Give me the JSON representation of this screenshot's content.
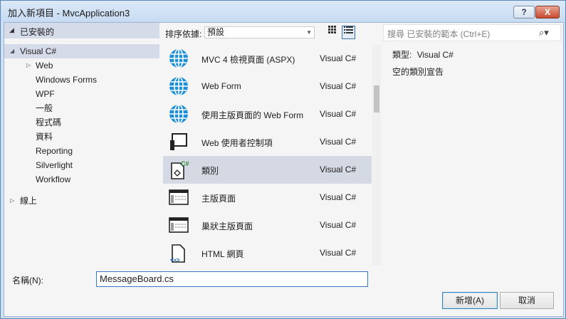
{
  "window": {
    "title": "加入新項目 - MvcApplication3",
    "help_label": "?",
    "close_label": "X"
  },
  "left_panel": {
    "header": "已安裝的",
    "tree": [
      {
        "label": "Visual C#",
        "level": 0,
        "expander": "◢",
        "selected": true
      },
      {
        "label": "Web",
        "level": 1,
        "expander": "▷"
      },
      {
        "label": "Windows Forms",
        "level": 1
      },
      {
        "label": "WPF",
        "level": 1
      },
      {
        "label": "一般",
        "level": 1
      },
      {
        "label": "程式碼",
        "level": 1
      },
      {
        "label": "資料",
        "level": 1
      },
      {
        "label": "Reporting",
        "level": 1
      },
      {
        "label": "Silverlight",
        "level": 1
      },
      {
        "label": "Workflow",
        "level": 1
      },
      {
        "label": "線上",
        "level": 0,
        "expander": "▷"
      }
    ]
  },
  "toolbar": {
    "sort_label": "排序依據:",
    "sort_value": "預設"
  },
  "templates": [
    {
      "name": "MVC 4 檢視頁面 (ASPX)",
      "lang": "Visual C#",
      "icon": "globe-icon"
    },
    {
      "name": "Web Form",
      "lang": "Visual C#",
      "icon": "globe-icon"
    },
    {
      "name": "使用主版頁面的 Web Form",
      "lang": "Visual C#",
      "icon": "globe-icon"
    },
    {
      "name": "Web 使用者控制項",
      "lang": "Visual C#",
      "icon": "user-control-icon"
    },
    {
      "name": "類別",
      "lang": "Visual C#",
      "icon": "class-file-icon",
      "selected": true
    },
    {
      "name": "主版頁面",
      "lang": "Visual C#",
      "icon": "master-page-icon"
    },
    {
      "name": "巢狀主版頁面",
      "lang": "Visual C#",
      "icon": "master-page-icon"
    },
    {
      "name": "HTML 網頁",
      "lang": "Visual C#",
      "icon": "html-page-icon"
    }
  ],
  "search": {
    "placeholder": "搜尋 已安裝的範本 (Ctrl+E)"
  },
  "info": {
    "type_label": "類型:",
    "type_value": "Visual C#",
    "description": "空的類別宣告"
  },
  "name_field": {
    "label": "名稱(N):",
    "value": "MessageBoard.cs"
  },
  "buttons": {
    "add": "新增(A)",
    "cancel": "取消"
  },
  "colors": {
    "accent": "#3a78c3",
    "selection": "#d5d9e4",
    "globe": "#1f8fd8"
  }
}
